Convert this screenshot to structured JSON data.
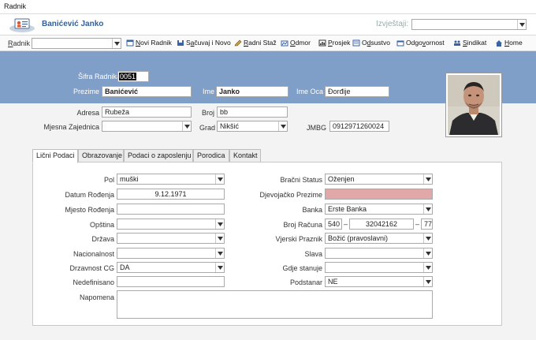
{
  "window": {
    "title": "Radnik"
  },
  "header": {
    "name": "Banićević Janko",
    "izvjestaji_label": "Izvještaji:",
    "izvjestaji_value": ""
  },
  "toolbar": {
    "radnik_label": "Radnik",
    "radnik_value": "",
    "buttons": [
      {
        "pre": "",
        "ul": "N",
        "rest": "ovi Radnik",
        "icon": "new-record-icon"
      },
      {
        "pre": "S",
        "ul": "a",
        "rest": "čuvaj i Novo",
        "icon": "save-icon"
      },
      {
        "pre": "",
        "ul": "R",
        "rest": "adni Staž",
        "icon": "pencil-icon"
      },
      {
        "pre": "",
        "ul": "O",
        "rest": "dmor",
        "icon": "vacation-icon"
      },
      {
        "pre": "",
        "ul": "P",
        "rest": "rosjek",
        "icon": "average-icon"
      },
      {
        "pre": "O",
        "ul": "d",
        "rest": "sustvo",
        "icon": "absence-icon"
      },
      {
        "pre": "Odgo",
        "ul": "v",
        "rest": "ornost",
        "icon": "responsibility-icon"
      },
      {
        "pre": "",
        "ul": "S",
        "rest": "indikat",
        "icon": "union-icon"
      },
      {
        "pre": "",
        "ul": "H",
        "rest": "ome",
        "icon": "home-icon"
      }
    ]
  },
  "employee": {
    "sifra_label": "Šifra Radnika",
    "sifra": "0051",
    "prezime_label": "Prezime",
    "prezime": "Banićević",
    "ime_label": "Ime",
    "ime": "Janko",
    "ime_oca_label": "Ime Oca",
    "ime_oca": "Đorđije",
    "adresa_label": "Adresa",
    "adresa": "Rubeža",
    "broj_label": "Broj",
    "broj": "bb",
    "mz_label": "Mjesna Zajednica",
    "mz": "",
    "grad_label": "Grad",
    "grad": "Nikšić",
    "jmbg_label": "JMBG",
    "jmbg": "0912971260024"
  },
  "tabs": [
    "Lični Podaci",
    "Obrazovanje",
    "Podaci o zaposlenju",
    "Porodica",
    "Kontakt"
  ],
  "personal": {
    "pol_label": "Pol",
    "pol": "muški",
    "datum_label": "Datum Rođenja",
    "datum": "9.12.1971",
    "mjesto_label": "Mjesto Rođenja",
    "mjesto": "",
    "opstina_label": "Opština",
    "opstina": "",
    "drzava_label": "Država",
    "drzava": "",
    "nacionalnost_label": "Nacionalnost",
    "nacionalnost": "",
    "drzavnost_label": "Drzavnost CG",
    "drzavnost": "DA",
    "nedefinisano_label": "Nedefinisano",
    "nedefinisano": "",
    "napomena_label": "Napomena",
    "napomena": "",
    "bracni_label": "Bračni Status",
    "bracni": "Oženjen",
    "djevojacko_label": "Djevojačko Prezime",
    "djevojacko": "",
    "banka_label": "Banka",
    "banka": "Erste Banka",
    "racun_label": "Broj Računa",
    "racun1": "540",
    "racun2": "32042162",
    "racun3": "77",
    "racun_sep": "–",
    "praznik_label": "Vjerski Praznik",
    "praznik": "Božić (pravoslavni)",
    "slava_label": "Slava",
    "slava": "",
    "stanuje_label": "Gdje stanuje",
    "stanuje": "",
    "podstanar_label": "Podstanar",
    "podstanar": "NE"
  },
  "colors": {
    "band": "#7f9fc8",
    "title": "#335f96",
    "required_empty": "#e0a8a8"
  }
}
